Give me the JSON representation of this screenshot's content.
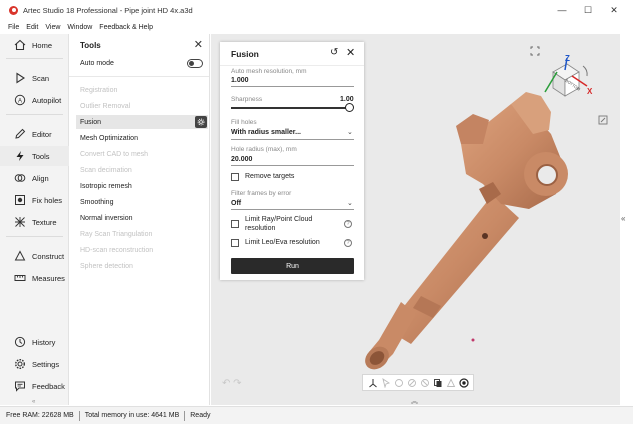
{
  "window": {
    "title": "Artec Studio 18 Professional - Pipe joint HD 4x.a3d",
    "minimize": "—",
    "maximize": "☐",
    "close": "✕"
  },
  "menu": [
    "File",
    "Edit",
    "View",
    "Window",
    "Feedback & Help"
  ],
  "nav": {
    "items": [
      {
        "label": "Home",
        "icon": "home-icon"
      },
      {
        "label": "Scan",
        "icon": "play-icon"
      },
      {
        "label": "Autopilot",
        "icon": "autopilot-icon"
      },
      {
        "label": "Editor",
        "icon": "pencil-icon"
      },
      {
        "label": "Tools",
        "icon": "lightning-icon"
      },
      {
        "label": "Align",
        "icon": "align-icon"
      },
      {
        "label": "Fix holes",
        "icon": "fix-holes-icon"
      },
      {
        "label": "Texture",
        "icon": "texture-icon"
      },
      {
        "label": "Construct",
        "icon": "construct-icon"
      },
      {
        "label": "Measures",
        "icon": "measures-icon"
      },
      {
        "label": "History",
        "icon": "history-icon"
      },
      {
        "label": "Settings",
        "icon": "gear-icon"
      },
      {
        "label": "Feedback",
        "icon": "feedback-icon"
      }
    ],
    "collapse": "«"
  },
  "tools_panel": {
    "title": "Tools",
    "auto_mode_label": "Auto mode",
    "items": [
      {
        "label": "Registration",
        "state": "disabled"
      },
      {
        "label": "Outlier Removal",
        "state": "disabled"
      },
      {
        "label": "Fusion",
        "state": "active"
      },
      {
        "label": "Mesh Optimization",
        "state": "enabled"
      },
      {
        "label": "Convert CAD to mesh",
        "state": "disabled"
      },
      {
        "label": "Scan decimation",
        "state": "disabled"
      },
      {
        "label": "Isotropic remesh",
        "state": "enabled"
      },
      {
        "label": "Smoothing",
        "state": "enabled"
      },
      {
        "label": "Normal inversion",
        "state": "enabled"
      },
      {
        "label": "Ray Scan Triangulation",
        "state": "disabled"
      },
      {
        "label": "HD-scan reconstruction",
        "state": "disabled"
      },
      {
        "label": "Sphere detection",
        "state": "disabled"
      }
    ]
  },
  "fusion_panel": {
    "title": "Fusion",
    "max_resolution_label": "Auto mesh resolution, mm",
    "max_resolution_value": "1.000",
    "sharpness_label": "Sharpness",
    "sharpness_value": "1.00",
    "fill_holes_label": "Fill holes",
    "fill_holes_value": "With radius smaller...",
    "hole_radius_label": "Hole radius (max), mm",
    "hole_radius_value": "20.000",
    "remove_targets_label": "Remove targets",
    "filter_frames_label": "Filter frames by error",
    "filter_frames_value": "Off",
    "limit_ray_label_1": "Limit Ray/Point Cloud",
    "limit_ray_label_2": "resolution",
    "limit_leo_label": "Limit Leo/Eva resolution",
    "help": "?",
    "run_label": "Run"
  },
  "orientation_cube": {
    "face_label": "BOTTOM",
    "x": "X",
    "z": "Z"
  },
  "statusbar": {
    "free_ram": "Free RAM: 22628 MB",
    "total_memory": "Total memory in use: 4641 MB",
    "state": "Ready"
  },
  "viewport": {
    "side_collapse": "«",
    "expand_up": "︽",
    "undo": "↶",
    "redo": "↷"
  },
  "colors": {
    "model": "#c98a66",
    "accent_dark": "#2a2a2a",
    "axis_x": "#d62828",
    "axis_z": "#1e56c8",
    "axis_y": "#2a9d3a"
  }
}
